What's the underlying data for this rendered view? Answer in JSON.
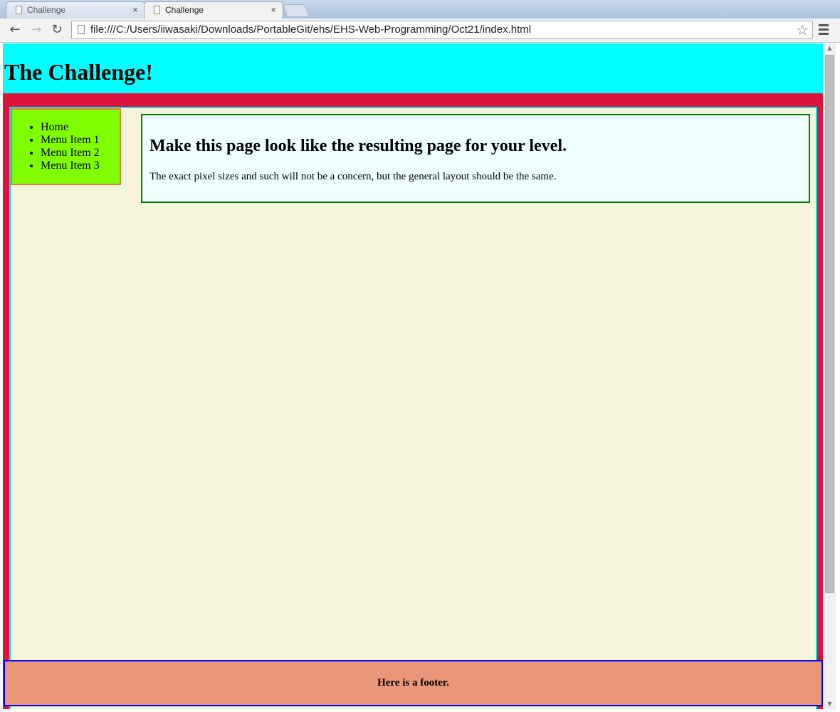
{
  "browser": {
    "tabs": [
      {
        "title": "Challenge",
        "close": "×",
        "active": false
      },
      {
        "title": "Challenge",
        "close": "×",
        "active": true
      }
    ],
    "url": "file:///C:/Users/iiwasaki/Downloads/PortableGit/ehs/EHS-Web-Programming/Oct21/index.html",
    "icons": {
      "back": "back-arrow-icon",
      "forward": "forward-arrow-icon",
      "reload": "reload-icon",
      "star": "bookmark-star-icon",
      "menu": "hamburger-menu-icon"
    }
  },
  "page": {
    "header_title": "The Challenge!",
    "nav": {
      "items": [
        "Home",
        "Menu Item 1",
        "Menu Item 2",
        "Menu Item 3"
      ]
    },
    "panel": {
      "heading": "Make this page look like the resulting page for your level.",
      "text": "The exact pixel sizes and such will not be a concern, but the general layout should be the same."
    },
    "footer_text": "Here is a footer."
  },
  "colors": {
    "header_bg": "#00ffff",
    "main_bg": "#dc143c",
    "content_bg": "#f5f5dc",
    "sidebar_bg": "#7fff00",
    "panel_bg": "#f0ffff",
    "panel_border": "#008000",
    "footer_bg": "#e9967a",
    "footer_border": "#0000ff"
  }
}
